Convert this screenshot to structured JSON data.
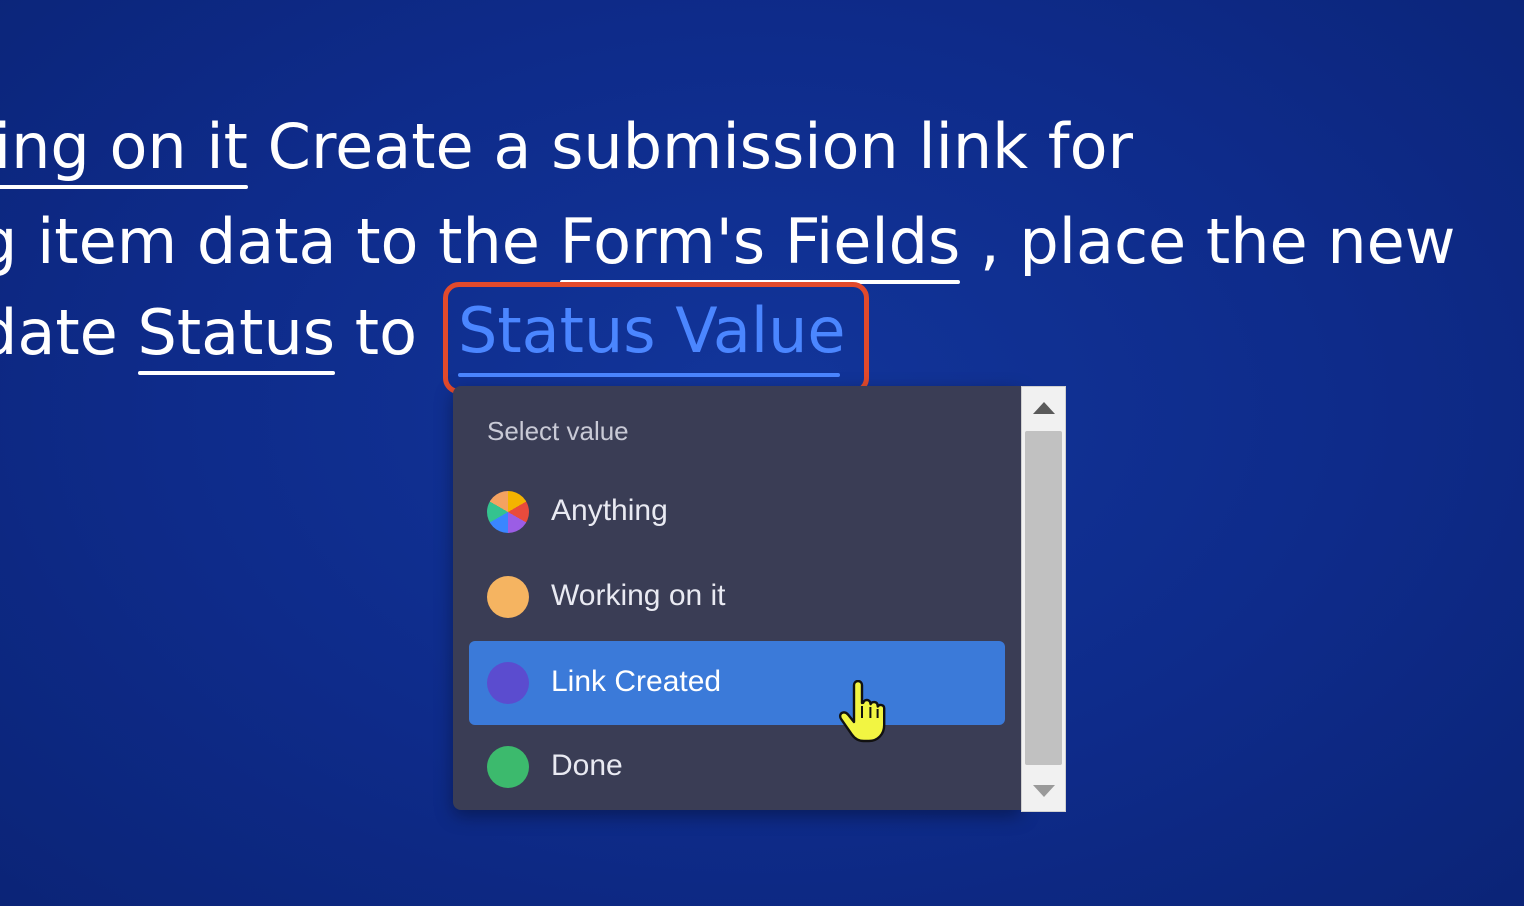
{
  "sentence": {
    "line1": {
      "link_fragment": "king on it",
      "text": " Create a submission link for"
    },
    "line2": {
      "text_before": "g item data to the ",
      "link": "Form's Fields",
      "text_after": " , place the new"
    },
    "line3": {
      "text_before": "date ",
      "link": "Status",
      "text_middle": " to "
    },
    "highlighted_link": "Status Value"
  },
  "dropdown": {
    "header": "Select value",
    "selected_index": 2,
    "options": [
      {
        "label": "Anything",
        "color": "multicolor"
      },
      {
        "label": "Working on it",
        "color": "#f5b461"
      },
      {
        "label": "Link Created",
        "color": "#5b4ccf"
      },
      {
        "label": "Done",
        "color": "#3cba6d"
      }
    ]
  },
  "colors": {
    "background": "#0e2b8a",
    "highlight_border": "#e24a2c",
    "link_blue": "#4b86ff",
    "dropdown_bg": "#3a3d55",
    "selected_bg": "#3b7ad9"
  }
}
